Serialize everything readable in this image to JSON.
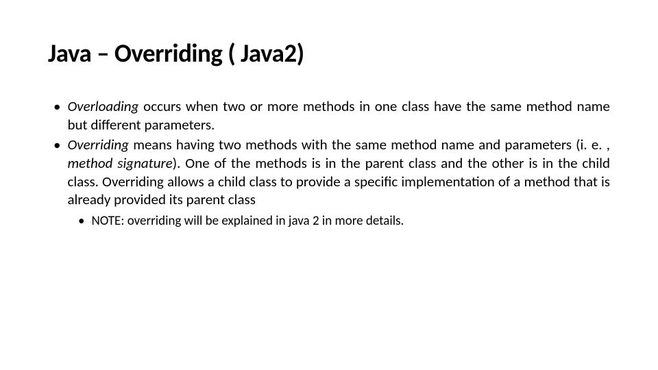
{
  "title": "Java – Overriding ( Java2)",
  "bullets": [
    {
      "emphasis": "Overloading",
      "rest": " occurs when two or more methods in one class have the same method name but different parameters."
    },
    {
      "emphasis": "Overriding",
      "rest_part1": " means having two methods with the same method name and parameters (i. e. , ",
      "emphasis2": "method signature",
      "rest_part2": "). One of the methods is in the parent class and the other is in the child class. Overriding allows a child class to provide a specific implementation of a method that is already provided its parent class"
    }
  ],
  "sub_bullet": "NOTE: overriding will be explained in java 2 in more details."
}
